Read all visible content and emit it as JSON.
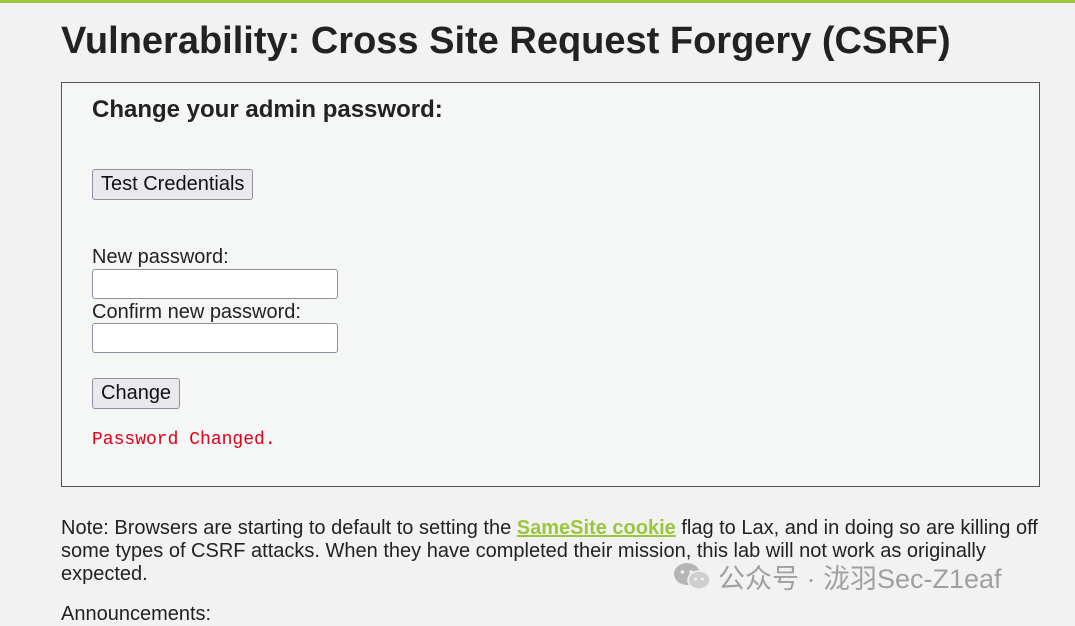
{
  "page": {
    "title": "Vulnerability: Cross Site Request Forgery (CSRF)"
  },
  "form": {
    "heading": "Change your admin password:",
    "test_button": "Test Credentials",
    "new_password_label": "New password:",
    "new_password_value": "",
    "confirm_password_label": "Confirm new password:",
    "confirm_password_value": "",
    "change_button": "Change",
    "status_message": "Password Changed."
  },
  "note": {
    "prefix": "Note: Browsers are starting to default to setting the ",
    "link_text": "SameSite cookie",
    "suffix": " flag to Lax, and in doing so are killing off some types of CSRF attacks. When they have completed their mission, this lab will not work as originally expected."
  },
  "announcements": {
    "label": "Announcements:"
  },
  "watermark": {
    "text": "公众号 · 泷羽Sec-Z1eaf",
    "icon": "wechat-icon"
  },
  "colors": {
    "accent": "#9bc53d",
    "error": "#e0001a",
    "background": "#f2f2f2"
  }
}
